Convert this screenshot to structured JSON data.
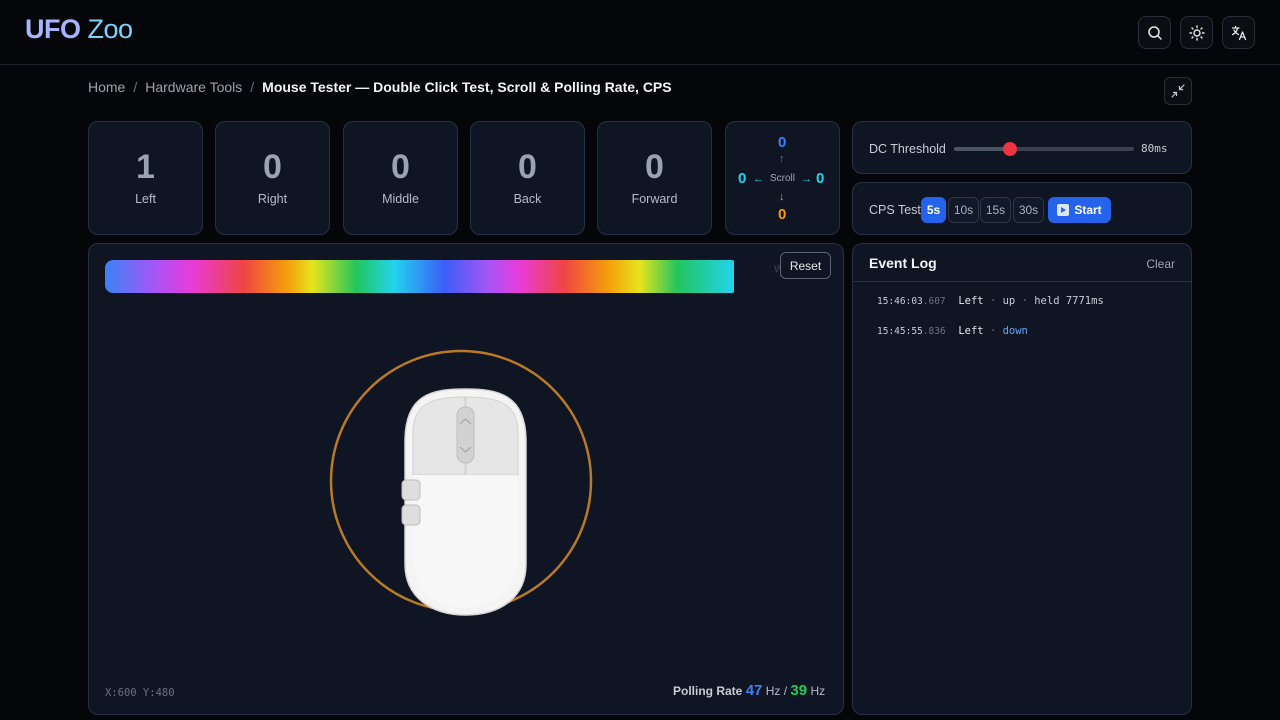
{
  "header": {
    "logo_part1": "UFO",
    "logo_part2": "Zoo",
    "icons": [
      "search-icon",
      "sun-icon",
      "translate-icon"
    ]
  },
  "breadcrumb": {
    "home": "Home",
    "section": "Hardware Tools",
    "current": "Mouse Tester — Double Click Test, Scroll & Polling Rate, CPS"
  },
  "counters": [
    {
      "value": "1",
      "label": "Left"
    },
    {
      "value": "0",
      "label": "Right"
    },
    {
      "value": "0",
      "label": "Middle"
    },
    {
      "value": "0",
      "label": "Back"
    },
    {
      "value": "0",
      "label": "Forward"
    }
  ],
  "scroll": {
    "label": "Scroll",
    "up": "0",
    "down": "0",
    "left": "0",
    "right": "0",
    "up_arrow": "↑",
    "down_arrow": "↓",
    "left_arrow": "←",
    "right_arrow": "→"
  },
  "dc_threshold": {
    "label": "DC Threshold",
    "value": "80ms",
    "level_fraction": 0.31
  },
  "cps_test": {
    "label": "CPS Test",
    "durations": [
      "5s",
      "10s",
      "15s",
      "30s"
    ],
    "selected": "5s",
    "start_label": "Start"
  },
  "tester": {
    "reset_label": "Reset",
    "hint": "W",
    "coords": "X:600 Y:480",
    "polling_label": "Polling Rate",
    "polling_value_1": "47",
    "polling_value_2": "39",
    "hz_unit": "Hz",
    "separator": "/",
    "progress_fraction": 0.83
  },
  "event_log": {
    "title": "Event Log",
    "clear_label": "Clear",
    "entries": [
      {
        "time": "15:46:03",
        "ms": ".607",
        "button": "Left",
        "action": "up",
        "detail": "held 7771ms"
      },
      {
        "time": "15:45:55",
        "ms": ".836",
        "button": "Left",
        "action": "down",
        "detail": ""
      }
    ]
  },
  "colors": {
    "accent": "#2563eb",
    "threshold_thumb": "#ef3340",
    "polling_primary": "#3b82f6",
    "polling_secondary": "#22c55e",
    "ring": "#b87a26",
    "scroll_vertical": "#3b82f6",
    "scroll_horizontal": "#22d3ee",
    "scroll_down": "#f59e0b"
  }
}
